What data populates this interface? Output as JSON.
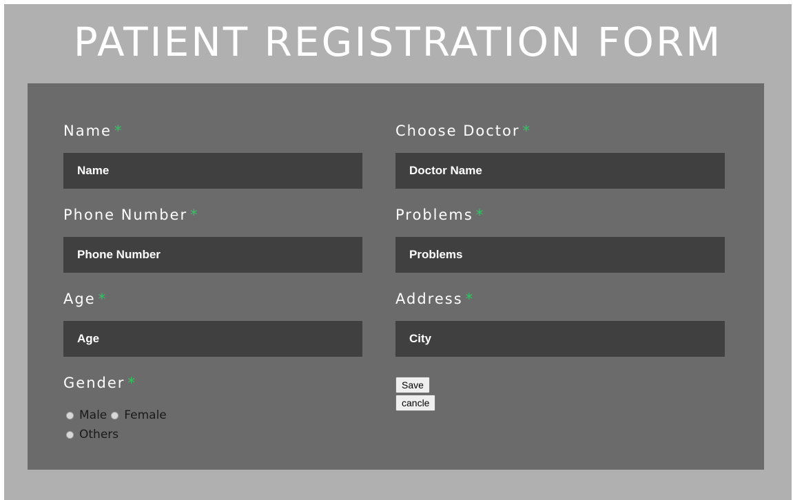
{
  "title": "PATIENT REGISTRATION FORM",
  "required_marker": "*",
  "fields": {
    "name": {
      "label": "Name",
      "placeholder": "Name"
    },
    "phone": {
      "label": "Phone Number",
      "placeholder": "Phone Number"
    },
    "age": {
      "label": "Age",
      "placeholder": "Age"
    },
    "doctor": {
      "label": "Choose Doctor",
      "placeholder": "Doctor Name"
    },
    "problems": {
      "label": "Problems",
      "placeholder": "Problems"
    },
    "address": {
      "label": "Address",
      "placeholder": "City"
    }
  },
  "gender": {
    "label": "Gender",
    "options": [
      "Male",
      "Female",
      "Others"
    ]
  },
  "buttons": {
    "save": "Save",
    "cancel": "cancle"
  },
  "colors": {
    "page_bg": "#b0b0b0",
    "panel_bg": "#6b6b6b",
    "input_bg": "#404040",
    "required": "#2ec760"
  }
}
